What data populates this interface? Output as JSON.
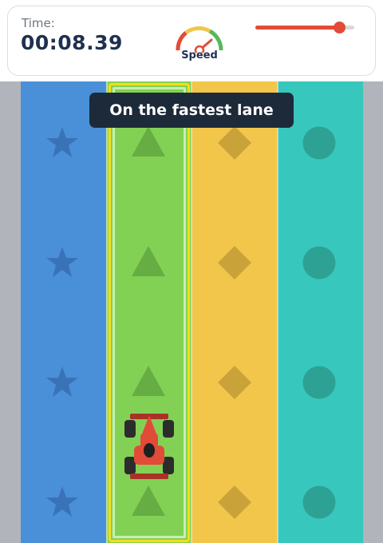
{
  "hud": {
    "time_label": "Time:",
    "time_value": "00:08.39",
    "speed_label": "Speed",
    "speed_level": 0.85
  },
  "lanes": [
    {
      "name": "blue-star-lane",
      "color": "#4a90d9",
      "marker": "star",
      "marker_color": "#3a72b8"
    },
    {
      "name": "green-triangle-lane",
      "color": "#82d155",
      "marker": "triangle",
      "marker_color": "#66ad44",
      "selected": true
    },
    {
      "name": "yellow-diamond-lane",
      "color": "#f2c64b",
      "marker": "diamond",
      "marker_color": "#c9a23a"
    },
    {
      "name": "teal-circle-lane",
      "color": "#38c7bc",
      "marker": "circle",
      "marker_color": "#2ea195"
    }
  ],
  "tooltip": {
    "text": "On the fastest lane"
  },
  "car": {
    "icon": "race-car-icon",
    "color": "#e14b38",
    "lane_index": 1
  },
  "colors": {
    "accent": "#e14b38",
    "text_dark": "#1f3050",
    "highlight": "#f6dd17"
  }
}
